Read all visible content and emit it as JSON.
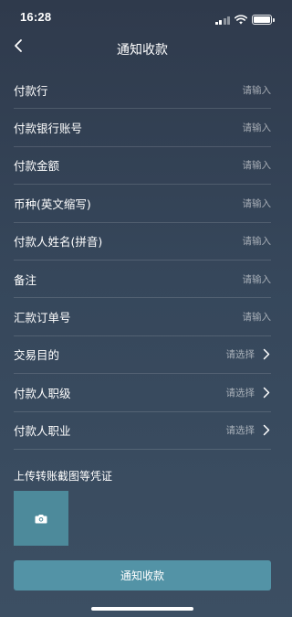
{
  "status_bar": {
    "time": "16:28",
    "icons": [
      "signal-icon",
      "wifi-icon",
      "battery-icon"
    ]
  },
  "nav": {
    "title": "通知收款",
    "back_icon": "chevron-left-icon"
  },
  "form": {
    "rows": [
      {
        "label": "付款行",
        "hint": "请输入",
        "type": "input"
      },
      {
        "label": "付款银行账号",
        "hint": "请输入",
        "type": "input"
      },
      {
        "label": "付款金额",
        "hint": "请输入",
        "type": "input"
      },
      {
        "label": "币种(英文缩写)",
        "hint": "请输入",
        "type": "input"
      },
      {
        "label": "付款人姓名(拼音)",
        "hint": "请输入",
        "type": "input"
      },
      {
        "label": "备注",
        "hint": "请输入",
        "type": "input"
      },
      {
        "label": "汇款订单号",
        "hint": "请输入",
        "type": "input"
      },
      {
        "label": "交易目的",
        "hint": "请选择",
        "type": "select"
      },
      {
        "label": "付款人职级",
        "hint": "请选择",
        "type": "select"
      },
      {
        "label": "付款人职业",
        "hint": "请选择",
        "type": "select"
      }
    ]
  },
  "upload": {
    "title": "上传转账截图等凭证",
    "icon": "camera-icon"
  },
  "submit": {
    "label": "通知收款"
  },
  "colors": {
    "accent": "#5393a6",
    "upload_box": "#4d8a9b",
    "background_top": "#2f3a4c",
    "background_bottom": "#3c4f63"
  }
}
